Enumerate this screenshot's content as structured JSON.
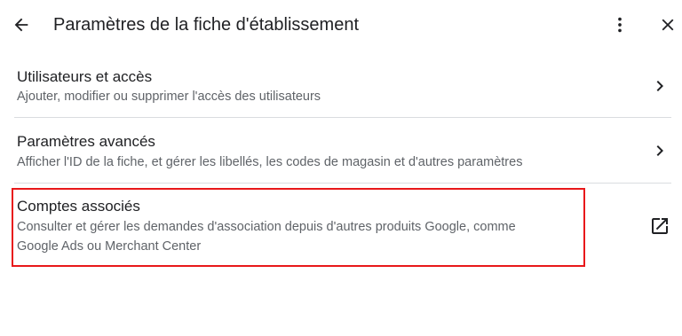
{
  "header": {
    "title": "Paramètres de la fiche d'établissement",
    "back_icon": "arrow-left-icon",
    "more_icon": "more-vert-icon",
    "close_icon": "close-icon"
  },
  "items": [
    {
      "title": "Utilisateurs et accès",
      "subtitle": "Ajouter, modifier ou supprimer l'accès des utilisateurs",
      "action_icon": "chevron-right-icon"
    },
    {
      "title": "Paramètres avancés",
      "subtitle": "Afficher l'ID de la fiche, et gérer les libellés, les codes de magasin et d'autres paramètres",
      "action_icon": "chevron-right-icon"
    },
    {
      "title": "Comptes associés",
      "subtitle_line1": "Consulter et gérer les demandes d'association depuis d'autres produits Google, comme",
      "subtitle_line2": "Google Ads ou Merchant Center",
      "action_icon": "open-in-new-icon",
      "highlighted": true
    }
  ],
  "colors": {
    "text_primary": "#202124",
    "text_secondary": "#5f6368",
    "divider": "#dadce0",
    "highlight": "#e8181a"
  }
}
